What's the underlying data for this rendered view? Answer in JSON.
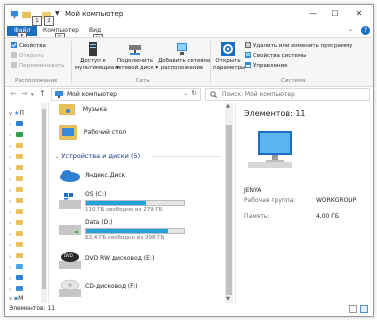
{
  "window": {
    "title": "Мой компьютер",
    "minimize": "—",
    "maximize": "☐",
    "close": "✕",
    "keytips": {
      "qat_undo": "1",
      "qat_down": "2",
      "qat_prop": "3",
      "tab_file": "F",
      "tab_computer": "C",
      "tab_view": "V",
      "help": "?"
    }
  },
  "ribbon_tabs": {
    "file": "Файл",
    "computer": "Компьютер",
    "view": "Вид"
  },
  "ribbon": {
    "properties": "Свойства",
    "open": "Открыть",
    "rename": "Переименовать",
    "group_location": "Расположение",
    "media_access_1": "Доступ к",
    "media_access_2": "мультимедиа",
    "map_drive_1": "Подключить",
    "map_drive_2": "сетевой диск",
    "add_location_1": "Добавить сетевое",
    "add_location_2": "расположение",
    "group_network": "Сеть",
    "open_settings_1": "Открыть",
    "open_settings_2": "параметры",
    "uninstall": "Удалить или изменить программу",
    "system_props": "Свойства системы",
    "manage": "Управление",
    "group_system": "Система"
  },
  "address": {
    "path": "Мой компьютер",
    "search_placeholder": "Поиск: Мой компьютер"
  },
  "nav_pane": {
    "items": [
      {
        "label": "П"
      },
      {
        "label": ""
      },
      {
        "label": ""
      },
      {
        "label": ""
      },
      {
        "label": ""
      },
      {
        "label": ""
      },
      {
        "label": ""
      },
      {
        "label": ""
      },
      {
        "label": ""
      },
      {
        "label": ""
      },
      {
        "label": ""
      },
      {
        "label": ""
      },
      {
        "label": ""
      },
      {
        "label": ""
      },
      {
        "label": ""
      },
      {
        "label": ""
      },
      {
        "label": ""
      },
      {
        "label": ""
      },
      {
        "label": "M"
      }
    ]
  },
  "content": {
    "folders": [
      {
        "name": "Музыка"
      },
      {
        "name": "Рабочий стол"
      }
    ],
    "section_title": "Устройства и диски (5)",
    "cloud": "Яндекс.Диск",
    "drives": [
      {
        "name": "OS (C:)",
        "free_text": "110 ГБ свободно из 279 ГБ",
        "used_fraction": 0.61
      },
      {
        "name": "Data (D:)",
        "free_text": "63,4 ГБ свободно из 398 ГБ",
        "used_fraction": 0.84
      }
    ],
    "dvd_label": "DVD RW дисковод (E:)",
    "dvd_badge": "DVD",
    "cd_label": "CD-дисковод (F:)"
  },
  "details": {
    "title": "Элементов: 11",
    "computer_name": "JENYA",
    "workgroup_label": "Рабочая группа:",
    "workgroup_value": "WORKGROUP",
    "memory_label": "Память:",
    "memory_value": "4,00 ГБ"
  },
  "status": {
    "items_text": "Элементов: 11"
  },
  "colors": {
    "accent": "#1a6fc4",
    "drive_bar": "#26a0da",
    "section_header": "#1e3287",
    "folder": "#e8c15a"
  }
}
